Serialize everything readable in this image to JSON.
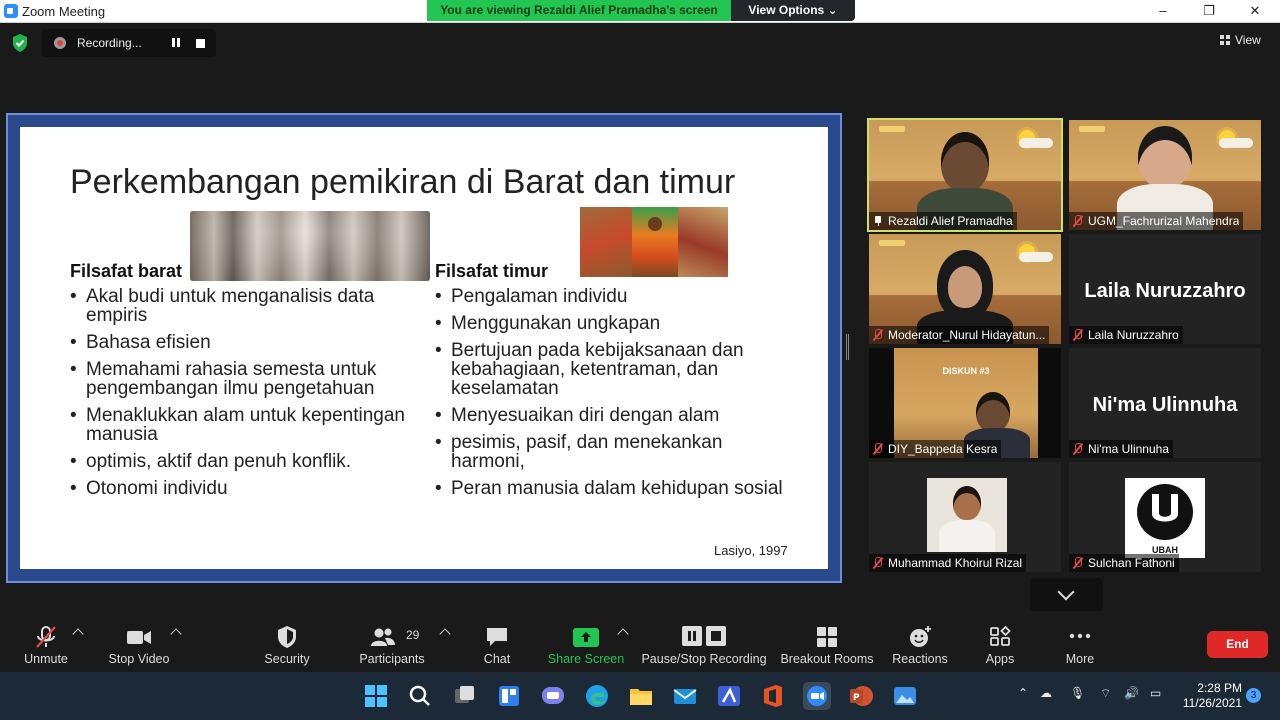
{
  "window": {
    "title": "Zoom Meeting",
    "viewing_banner": "You are viewing Rezaldi Alief Pramadha's screen",
    "view_options": "View Options ⌄",
    "minimize": "–",
    "maximize": "❐",
    "close": "✕"
  },
  "topbar": {
    "recording_label": "Recording...",
    "view_label": "View"
  },
  "slide": {
    "title": "Perkembangan pemikiran di Barat dan timur",
    "west_heading": "Filsafat barat",
    "west_items": [
      "Akal budi untuk menganalisis data empiris",
      "Bahasa efisien",
      "Memahami rahasia semesta untuk pengembangan ilmu pengetahuan",
      "Menaklukkan alam untuk kepentingan manusia",
      "optimis, aktif dan penuh konflik.",
      "Otonomi individu"
    ],
    "east_heading": "Filsafat timur",
    "east_items": [
      "Pengalaman individu",
      "Menggunakan ungkapan",
      "Bertujuan pada kebijaksanaan dan kebahagiaan, ketentraman, dan keselamatan",
      "Menyesuaikan diri dengan alam",
      "pesimis, pasif, dan menekankan harmoni,",
      "Peran manusia dalam kehidupan sosial"
    ],
    "citation": "Lasiyo, 1997"
  },
  "participants": [
    {
      "name": "Rezaldi Alief Pramadha",
      "muted": false
    },
    {
      "name": "UGM_Fachrurizal Mahendra",
      "muted": true
    },
    {
      "name": "Moderator_Nurul Hidayatun...",
      "muted": true
    },
    {
      "name": "Laila Nuruzzahro",
      "muted": true,
      "display_name": "Laila Nuruzzahro"
    },
    {
      "name": "DIY_Bappeda Kesra",
      "muted": true,
      "banner": "DISKUN #3"
    },
    {
      "name": "Ni'ma Ulinnuha",
      "muted": true,
      "display_name": "Ni'ma Ulinnuha"
    },
    {
      "name": "Muhammad Khoirul Rizal",
      "muted": true
    },
    {
      "name": "Sulchan Fathoni",
      "muted": true,
      "logo_text": "UBAH"
    }
  ],
  "toolbar": {
    "unmute": "Unmute",
    "stop_video": "Stop Video",
    "security": "Security",
    "participants_label": "Participants",
    "participants_count": "29",
    "chat": "Chat",
    "share_screen": "Share Screen",
    "pause_stop_recording": "Pause/Stop Recording",
    "breakout_rooms": "Breakout Rooms",
    "reactions": "Reactions",
    "apps": "Apps",
    "more": "More",
    "end": "End"
  },
  "taskbar": {
    "time": "2:28 PM",
    "date": "11/26/2021",
    "notifications": "3"
  },
  "colors": {
    "share_green": "#23c552",
    "end_red": "#e02828",
    "active_speaker": "#cfe06a",
    "slide_border": "#2b4a8e"
  }
}
